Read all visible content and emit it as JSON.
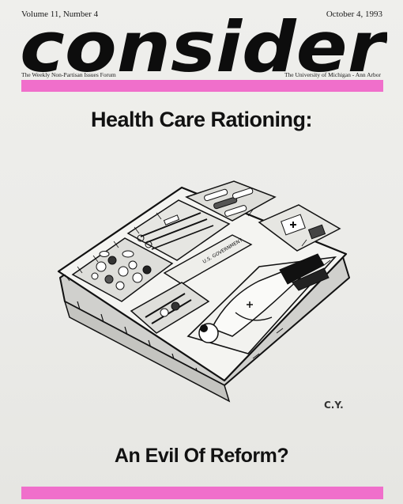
{
  "header": {
    "volume": "Volume 11, Number 4",
    "date": "October 4, 1993",
    "masthead_title": "consider",
    "tagline": "The Weekly Non-Partisan Issues Forum",
    "affiliation": "The University of Michigan - Ann Arbor"
  },
  "headline": {
    "top": "Health Care Rationing:",
    "bottom": "An Evil Of Reform?"
  },
  "cartoon": {
    "tray_label": "U.S. GOVERNMENT",
    "artist_initials": "C.Y."
  },
  "colors": {
    "accent_pink": "#f06fcb",
    "ink": "#111111",
    "paper": "#ececea"
  }
}
